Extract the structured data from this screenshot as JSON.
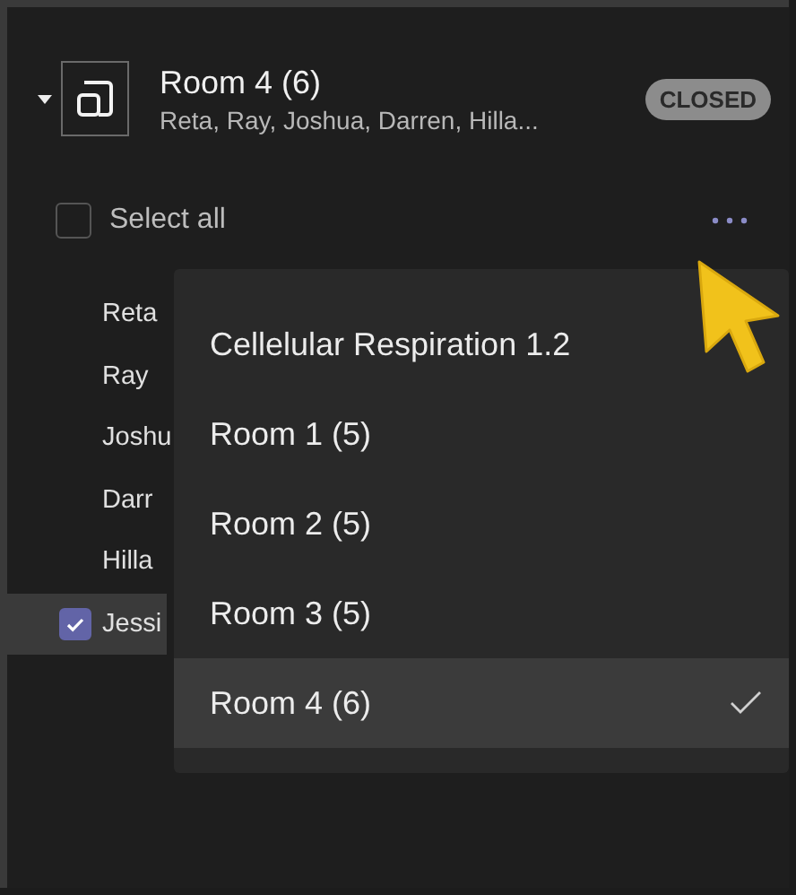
{
  "room": {
    "title": "Room 4 (6)",
    "members": "Reta, Ray, Joshua, Darren, Hilla...",
    "status": "CLOSED",
    "expanded": true
  },
  "select_all": {
    "label": "Select all",
    "checked": false
  },
  "participants": [
    {
      "name": "Reta",
      "checked": false
    },
    {
      "name": "Ray",
      "checked": false
    },
    {
      "name": "Joshu",
      "checked": false
    },
    {
      "name": "Darr",
      "checked": false
    },
    {
      "name": "Hilla",
      "checked": false
    },
    {
      "name": "Jessi",
      "checked": true
    }
  ],
  "menu": {
    "items": [
      {
        "label": "Cellelular Respiration 1.2",
        "selected": false
      },
      {
        "label": "Room 1 (5)",
        "selected": false
      },
      {
        "label": "Room 2 (5)",
        "selected": false
      },
      {
        "label": "Room 3 (5)",
        "selected": false
      },
      {
        "label": "Room 4 (6)",
        "selected": true
      }
    ]
  }
}
